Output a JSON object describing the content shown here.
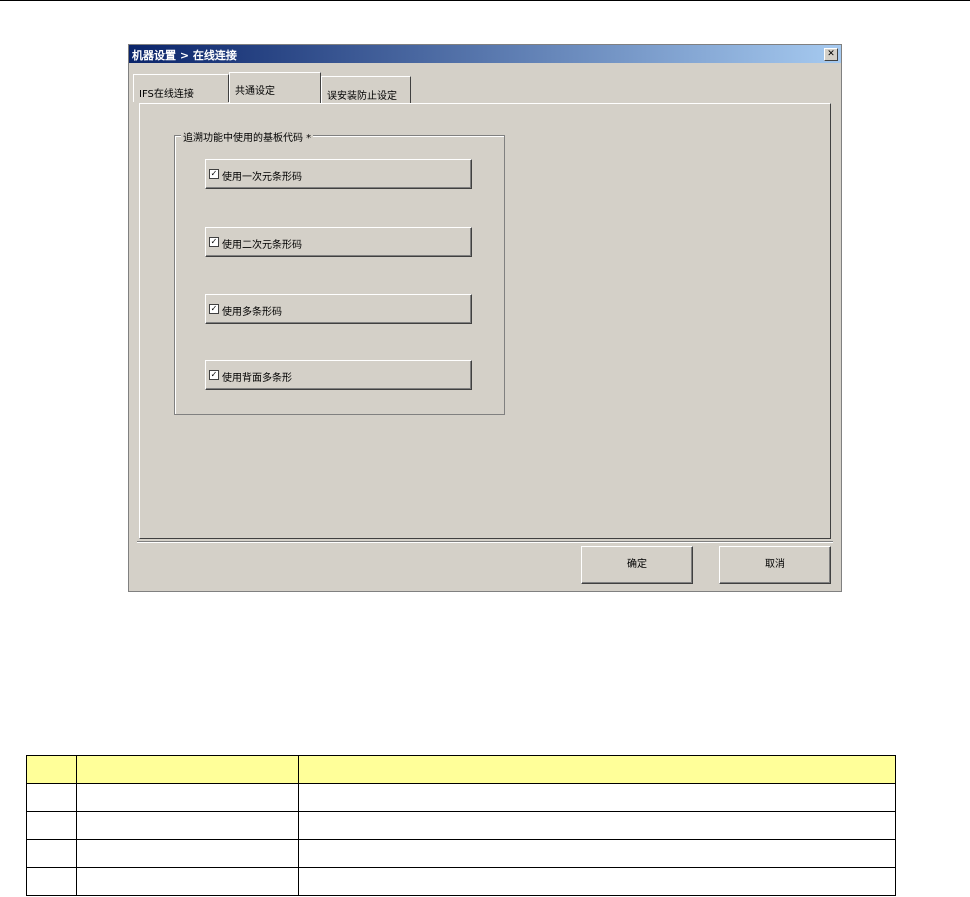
{
  "dialog": {
    "title": "机器设置 > 在线连接",
    "close_glyph": "✕",
    "tabs": [
      {
        "label": "IFS在线连接",
        "active": false
      },
      {
        "label": "共通设定",
        "active": true
      },
      {
        "label": "误安装防止设定",
        "active": false
      }
    ],
    "group": {
      "legend": "追溯功能中使用的基板代码 *",
      "options": [
        {
          "label": "使用一次元条形码",
          "checked": true
        },
        {
          "label": "使用二次元条形码",
          "checked": true
        },
        {
          "label": "使用多条形码",
          "checked": true
        },
        {
          "label": "使用背面多条形",
          "checked": true
        }
      ]
    },
    "buttons": {
      "ok": "确定",
      "cancel": "取消"
    }
  },
  "table": {
    "header_color": "#ffff99",
    "columns": [
      "",
      "",
      ""
    ],
    "rows": [
      [
        "",
        "",
        ""
      ],
      [
        "",
        "",
        ""
      ],
      [
        "",
        "",
        ""
      ],
      [
        "",
        "",
        ""
      ]
    ]
  },
  "icons": {
    "check": "check-icon",
    "close": "close-icon"
  }
}
